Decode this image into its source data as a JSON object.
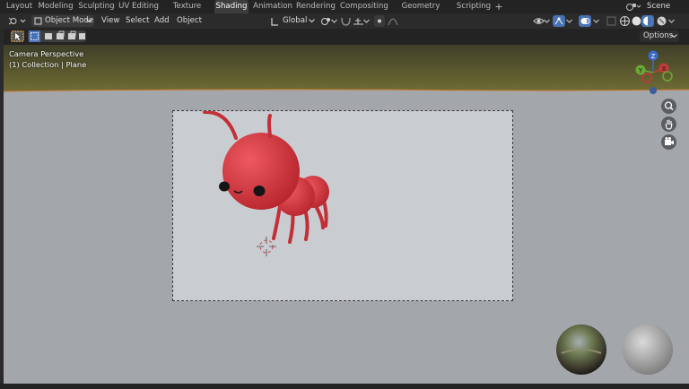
{
  "workspaces": [
    "Layout",
    "Modeling",
    "Sculpting",
    "UV Editing",
    "Texture Paint",
    "Shading",
    "Animation",
    "Rendering",
    "Compositing",
    "Geometry Nodes",
    "Scripting"
  ],
  "active_workspace": "Shading",
  "add_workspace": "+",
  "scene": {
    "label": "Scene"
  },
  "header": {
    "mode": "Object Mode",
    "menus": [
      "View",
      "Select",
      "Add",
      "Object"
    ],
    "orientation": "Global",
    "options": "Options"
  },
  "viewport": {
    "camera_label": "Camera Perspective",
    "collection_label": "(1) Collection | Plane"
  },
  "gizmo": {
    "z": "Z",
    "y": "Y",
    "x": "X"
  },
  "colors": {
    "accent": "#4772b3",
    "viewport_bg": "#a3a6aa",
    "ant_red": "#d9353e"
  }
}
